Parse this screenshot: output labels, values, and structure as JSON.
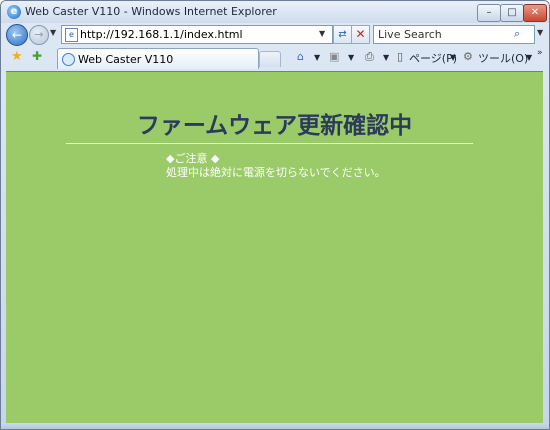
{
  "window": {
    "title": "Web Caster V110 - Windows Internet Explorer"
  },
  "address_bar": {
    "url": "http://192.168.1.1/index.html"
  },
  "search": {
    "placeholder": "Live Search"
  },
  "tabs": [
    {
      "label": "Web Caster V110"
    }
  ],
  "command_bar": {
    "page_label": "ページ(P)",
    "tools_label": "ツール(O)"
  },
  "page": {
    "heading": "ファームウェア更新確認中",
    "notice_title": "◆ご注意 ◆",
    "notice_body": "処理中は絶対に電源を切らないでください。",
    "background_color": "#9bcb69",
    "heading_color": "#2c3a5c"
  },
  "icons": [
    "ie-logo-icon",
    "back-arrow-icon",
    "forward-arrow-icon",
    "page-icon",
    "refresh-icon",
    "stop-icon",
    "search-icon",
    "favorites-star-icon",
    "add-favorites-icon",
    "tab-loading-icon",
    "home-icon",
    "feeds-icon",
    "print-icon",
    "page-menu-icon",
    "tools-gear-icon"
  ]
}
